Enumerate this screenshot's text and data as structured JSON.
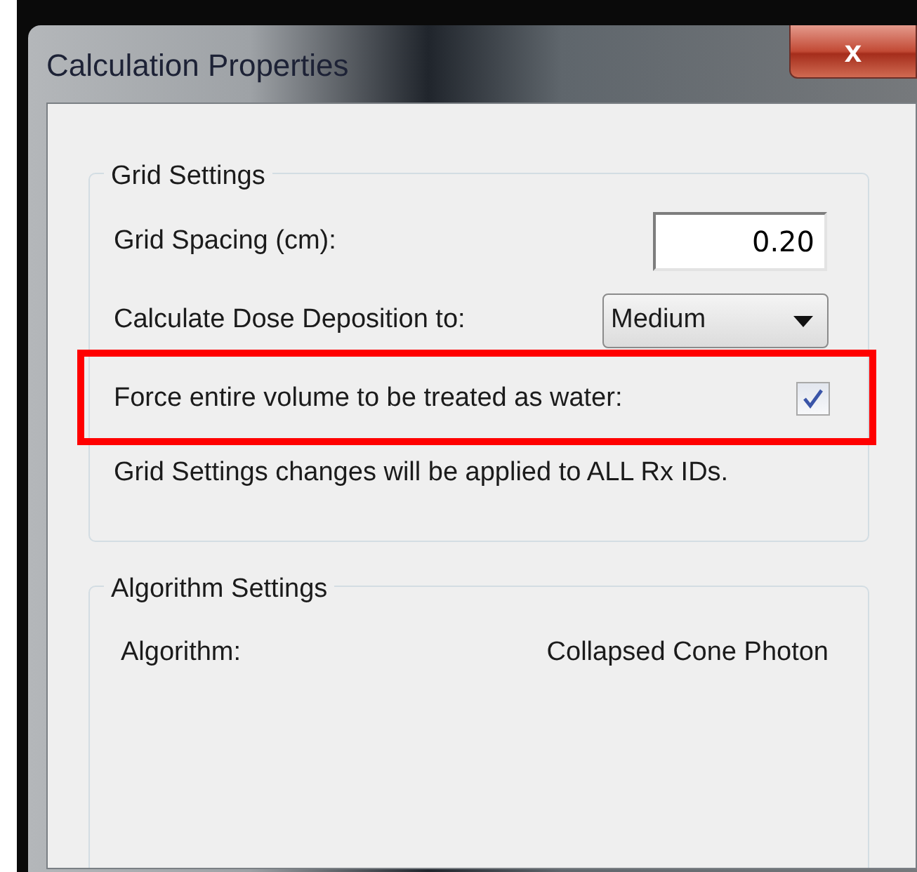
{
  "window": {
    "title": "Calculation Properties",
    "close_label": "x"
  },
  "grid_settings": {
    "title": "Grid Settings",
    "grid_spacing": {
      "label": "Grid Spacing (cm):",
      "value": "0.20"
    },
    "dose_deposition": {
      "label": "Calculate Dose Deposition to:",
      "value": "Medium"
    },
    "force_water": {
      "label": "Force entire volume to be treated as water:",
      "checked": true,
      "highlighted": true
    },
    "note": "Grid Settings changes will be applied to ALL Rx IDs."
  },
  "algorithm_settings": {
    "title": "Algorithm Settings",
    "rows": [
      {
        "label": "Algorithm:",
        "value": "Collapsed Cone Photon"
      }
    ]
  }
}
